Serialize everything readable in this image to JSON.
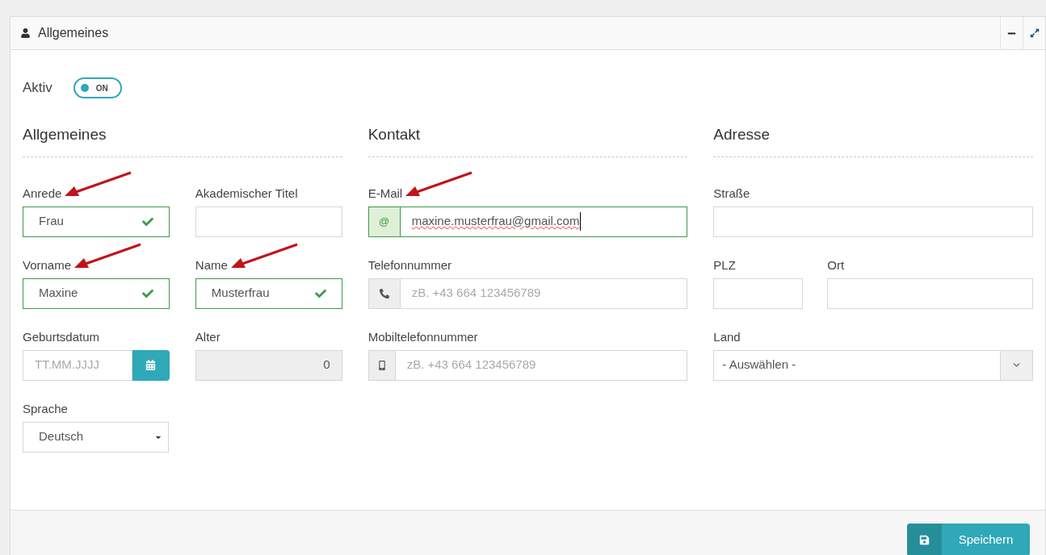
{
  "panel": {
    "title": "Allgemeines"
  },
  "active": {
    "label": "Aktiv",
    "on": true,
    "text": "ON"
  },
  "columns": [
    {
      "heading": "Allgemeines",
      "rows": [
        [
          {
            "label": "Anrede",
            "kind": "select",
            "value": "Frau",
            "valid": true,
            "marked": true
          },
          {
            "label": "Akademischer Titel",
            "kind": "text",
            "valid": false,
            "marked": false
          }
        ],
        [
          {
            "label": "Vorname",
            "kind": "text",
            "value": "Maxine",
            "valid": true,
            "marked": true
          },
          {
            "label": "Name",
            "kind": "text",
            "value": "Musterfrau",
            "valid": true,
            "marked": true
          }
        ],
        [
          {
            "label": "Geburtsdatum",
            "kind": "date",
            "placeholder": "TT.MM.JJJJ",
            "marked": false
          },
          {
            "label": "Alter",
            "kind": "readonly",
            "value": "0",
            "marked": false
          }
        ],
        [
          {
            "label": "Sprache",
            "kind": "dropdown",
            "value": "Deutsch",
            "marked": false
          }
        ]
      ]
    },
    {
      "heading": "Kontakt",
      "rows": [
        [
          {
            "label": "E-Mail",
            "kind": "email",
            "addon": "@",
            "value": "maxine.musterfrau@gmail.com",
            "valid": true,
            "marked": true
          }
        ],
        [
          {
            "label": "Telefonnummer",
            "kind": "phone",
            "placeholder": "zB. +43 664 123456789",
            "valid": false,
            "marked": false
          }
        ],
        [
          {
            "label": "Mobiltelefonnummer",
            "kind": "mobile",
            "placeholder": "zB. +43 664 123456789",
            "valid": false,
            "marked": false
          }
        ]
      ]
    },
    {
      "heading": "Adresse",
      "rows": [
        [
          {
            "label": "Straße",
            "kind": "text",
            "valid": false,
            "marked": false
          }
        ],
        [
          {
            "label": "PLZ",
            "kind": "text",
            "valid": false,
            "marked": false
          },
          {
            "label": "Ort",
            "kind": "text",
            "valid": false,
            "marked": false
          }
        ],
        [
          {
            "label": "Land",
            "kind": "select-box",
            "value": "- Auswählen -",
            "marked": false
          }
        ]
      ]
    }
  ],
  "save_button": "Speichern"
}
